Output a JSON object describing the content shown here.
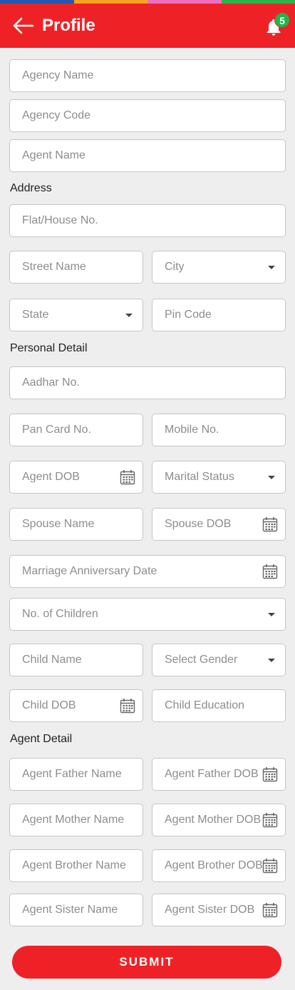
{
  "header": {
    "title": "Profile",
    "notification_count": "5",
    "stripe_colors": [
      "#2557b4",
      "#f4a41f",
      "#ee6ec0",
      "#2fb34b"
    ],
    "accent": "#ee2226"
  },
  "sections": {
    "address": "Address",
    "personal": "Personal Detail",
    "agent": "Agent Detail"
  },
  "fields": {
    "agency_name": "Agency Name",
    "agency_code": "Agency Code",
    "agent_name": "Agent Name",
    "flat_house": "Flat/House No.",
    "street_name": "Street Name",
    "city": "City",
    "state": "State",
    "pin_code": "Pin Code",
    "aadhar": "Aadhar No.",
    "pan_card": "Pan Card No.",
    "mobile": "Mobile No.",
    "agent_dob": "Agent DOB",
    "marital_status": "Marital Status",
    "spouse_name": "Spouse Name",
    "spouse_dob": "Spouse DOB",
    "anniversary": "Marriage Anniversary Date",
    "children": "No. of Children",
    "child_name": "Child Name",
    "select_gender": "Select Gender",
    "child_dob": "Child DOB",
    "child_education": "Child Education",
    "father_name": "Agent Father Name",
    "father_dob": "Agent Father DOB",
    "mother_name": "Agent Mother Name",
    "mother_dob": "Agent Mother DOB",
    "brother_name": "Agent Brother Name",
    "brother_dob": "Agent Brother DOB",
    "sister_name": "Agent Sister Name",
    "sister_dob": "Agent Sister DOB"
  },
  "submit_label": "SUBMIT"
}
